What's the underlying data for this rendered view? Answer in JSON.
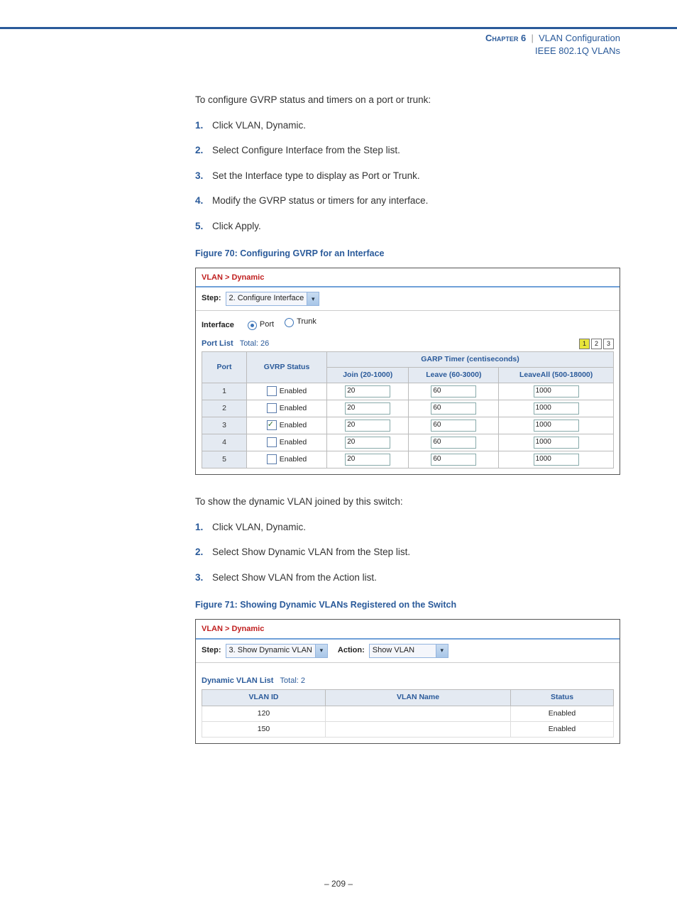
{
  "header": {
    "chapter_label": "Chapter 6",
    "separator": "|",
    "chapter_title": "VLAN Configuration",
    "subtitle": "IEEE 802.1Q VLANs"
  },
  "intro1": "To configure GVRP status and timers on a port or trunk:",
  "steps1": [
    "Click VLAN, Dynamic.",
    "Select Configure Interface from the Step list.",
    "Set the Interface type to display as Port or Trunk.",
    "Modify the GVRP status or timers for any interface.",
    "Click Apply."
  ],
  "fig70_caption": "Figure 70:  Configuring GVRP for an Interface",
  "fig70": {
    "breadcrumb": "VLAN > Dynamic",
    "step_label": "Step:",
    "step_value": "2. Configure Interface",
    "interface_label": "Interface",
    "radio_port": "Port",
    "radio_trunk": "Trunk",
    "portlist_label": "Port List",
    "portlist_total": "Total: 26",
    "pager": [
      "1",
      "2",
      "3"
    ],
    "th_port": "Port",
    "th_gvrp": "GVRP Status",
    "th_garp": "GARP Timer (centiseconds)",
    "th_join": "Join (20-1000)",
    "th_leave": "Leave (60-3000)",
    "th_leaveall": "LeaveAll (500-18000)",
    "rows": [
      {
        "port": "1",
        "checked": false,
        "label": "Enabled",
        "join": "20",
        "leave": "60",
        "leaveall": "1000"
      },
      {
        "port": "2",
        "checked": false,
        "label": "Enabled",
        "join": "20",
        "leave": "60",
        "leaveall": "1000"
      },
      {
        "port": "3",
        "checked": true,
        "label": "Enabled",
        "join": "20",
        "leave": "60",
        "leaveall": "1000"
      },
      {
        "port": "4",
        "checked": false,
        "label": "Enabled",
        "join": "20",
        "leave": "60",
        "leaveall": "1000"
      },
      {
        "port": "5",
        "checked": false,
        "label": "Enabled",
        "join": "20",
        "leave": "60",
        "leaveall": "1000"
      }
    ]
  },
  "intro2": "To show the dynamic VLAN joined by this switch:",
  "steps2": [
    "Click VLAN, Dynamic.",
    "Select Show Dynamic VLAN from the Step list.",
    "Select Show VLAN from the Action list."
  ],
  "fig71_caption": "Figure 71:  Showing Dynamic VLANs Registered on the Switch",
  "fig71": {
    "breadcrumb": "VLAN > Dynamic",
    "step_label": "Step:",
    "step_value": "3. Show Dynamic VLAN",
    "action_label": "Action:",
    "action_value": "Show VLAN",
    "list_title": "Dynamic VLAN List",
    "list_total": "Total: 2",
    "th_vlanid": "VLAN ID",
    "th_vlanname": "VLAN Name",
    "th_status": "Status",
    "rows": [
      {
        "id": "120",
        "name": "",
        "status": "Enabled"
      },
      {
        "id": "150",
        "name": "",
        "status": "Enabled"
      }
    ]
  },
  "page_number": "– 209 –"
}
